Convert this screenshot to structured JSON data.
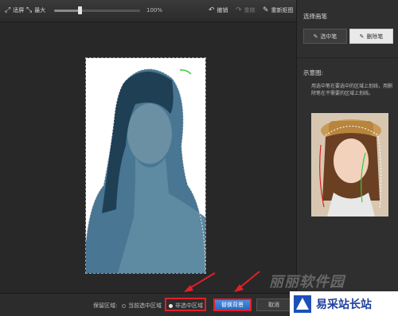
{
  "toolbar": {
    "fit_label": "适屏",
    "max_label": "最大",
    "zoom_value": "100%",
    "zoom_level": 0.3,
    "undo_label": "撤销",
    "redo_label": "重做",
    "redraw_label": "重新抠图"
  },
  "panel": {
    "select_pen_title": "选择画笔",
    "pen_select_label": "选中笔",
    "pen_delete_label": "删除笔",
    "example_title": "示意图:",
    "example_desc": "用选中笔在要选中的区域上划线，用删除笔在不需要的区域上划线。"
  },
  "bottom": {
    "keep_area_label": "保留区域:",
    "radio_selected_label": "当前选中区域",
    "radio_unselected_label": "非选中区域",
    "replace_bg_label": "替换背景",
    "cancel_label": "取消"
  },
  "watermark": {
    "site_text": "丽丽软件园",
    "logo_text": "易采站长站"
  },
  "colors": {
    "accent_blue": "#2a68c0",
    "highlight_red": "#e0202a",
    "selection_tint": "#3b6e8c"
  }
}
